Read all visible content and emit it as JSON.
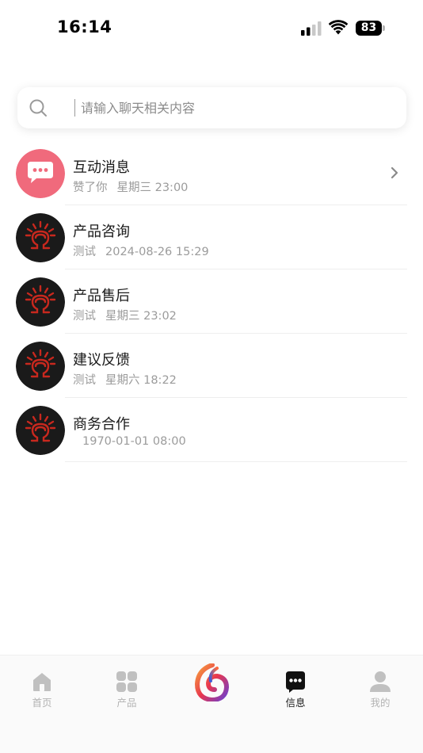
{
  "status_bar": {
    "time": "16:14",
    "battery": "83"
  },
  "search": {
    "placeholder": "请输入聊天相关内容"
  },
  "chats": [
    {
      "title": "互动消息",
      "preview": "赞了你",
      "time": "星期三 23:00",
      "avatar": "chat-bubble-icon"
    },
    {
      "title": "产品咨询",
      "preview": "测试",
      "time": "2024-08-26 15:29",
      "avatar": "brand-logo"
    },
    {
      "title": "产品售后",
      "preview": "测试",
      "time": "星期三 23:02",
      "avatar": "brand-logo"
    },
    {
      "title": "建议反馈",
      "preview": "测试",
      "time": "星期六 18:22",
      "avatar": "brand-logo"
    },
    {
      "title": "商务合作",
      "preview": "",
      "time": "1970-01-01 08:00",
      "avatar": "brand-logo"
    }
  ],
  "tabs": {
    "home": "首页",
    "products": "产品",
    "messages": "信息",
    "mine": "我的"
  },
  "colors": {
    "accent_pink": "#f06a7c",
    "logo_red": "#c8281e",
    "text_primary": "#1a1a1a",
    "text_secondary": "#9b9b9b"
  }
}
